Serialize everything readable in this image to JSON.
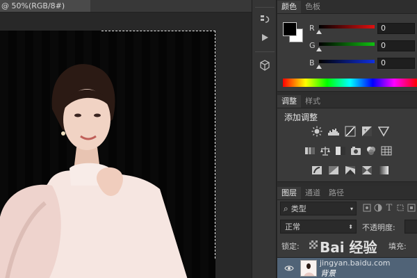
{
  "document": {
    "tab_title": "@ 50%(RGB/8#)"
  },
  "color_panel": {
    "tabs": [
      {
        "label": "颜色",
        "active": true
      },
      {
        "label": "色板",
        "active": false
      }
    ],
    "foreground": "#000000",
    "background": "#ffffff",
    "channels": [
      {
        "label": "R",
        "value": "0",
        "color": "#e01010"
      },
      {
        "label": "G",
        "value": "0",
        "color": "#10c010"
      },
      {
        "label": "B",
        "value": "0",
        "color": "#1030e0"
      }
    ]
  },
  "adjustments_panel": {
    "tabs": [
      {
        "label": "调整",
        "active": true
      },
      {
        "label": "样式",
        "active": false
      }
    ],
    "title": "添加调整",
    "row1_icons": [
      "brightness-icon",
      "levels-icon",
      "curves-icon",
      "exposure-icon",
      "vibrance-icon"
    ],
    "row2_icons": [
      "hue-saturation-icon",
      "color-balance-icon",
      "black-white-icon",
      "photo-filter-icon",
      "channel-mixer-icon",
      "color-lookup-icon"
    ],
    "row3_icons": [
      "invert-icon",
      "posterize-icon",
      "threshold-icon",
      "selective-color-icon",
      "gradient-map-icon"
    ]
  },
  "layers_panel": {
    "tabs": [
      {
        "label": "图层",
        "active": true
      },
      {
        "label": "通道",
        "active": false
      },
      {
        "label": "路径",
        "active": false
      }
    ],
    "kind_label": "类型",
    "blend_mode": "正常",
    "opacity_label": "不透明度:",
    "lock_label": "锁定:",
    "fill_label": "填充:",
    "layers": [
      {
        "name": "背景",
        "visible": true,
        "selected": true
      }
    ]
  },
  "watermark": {
    "brand": "Bai 经验",
    "url": "jingyan.baidu.com"
  }
}
